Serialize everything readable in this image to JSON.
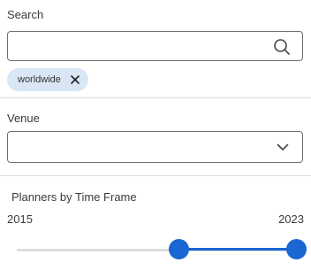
{
  "search": {
    "label": "Search",
    "value": "",
    "placeholder": "",
    "icon": "search-icon"
  },
  "chips": [
    {
      "label": "worldwide",
      "remove_icon": "close-icon"
    }
  ],
  "venue": {
    "label": "Venue",
    "selected": "",
    "icon": "chevron-down-icon"
  },
  "time_frame": {
    "label": "Planners by Time Frame",
    "min_label": "2015",
    "max_label": "2023",
    "selected_start_fraction": 0.58,
    "selected_end_fraction": 1.0
  },
  "colors": {
    "accent": "#1a66d2",
    "chip_bg": "#d8e6f6",
    "border": "#6f6f6f",
    "divider": "#dcdcdc"
  }
}
